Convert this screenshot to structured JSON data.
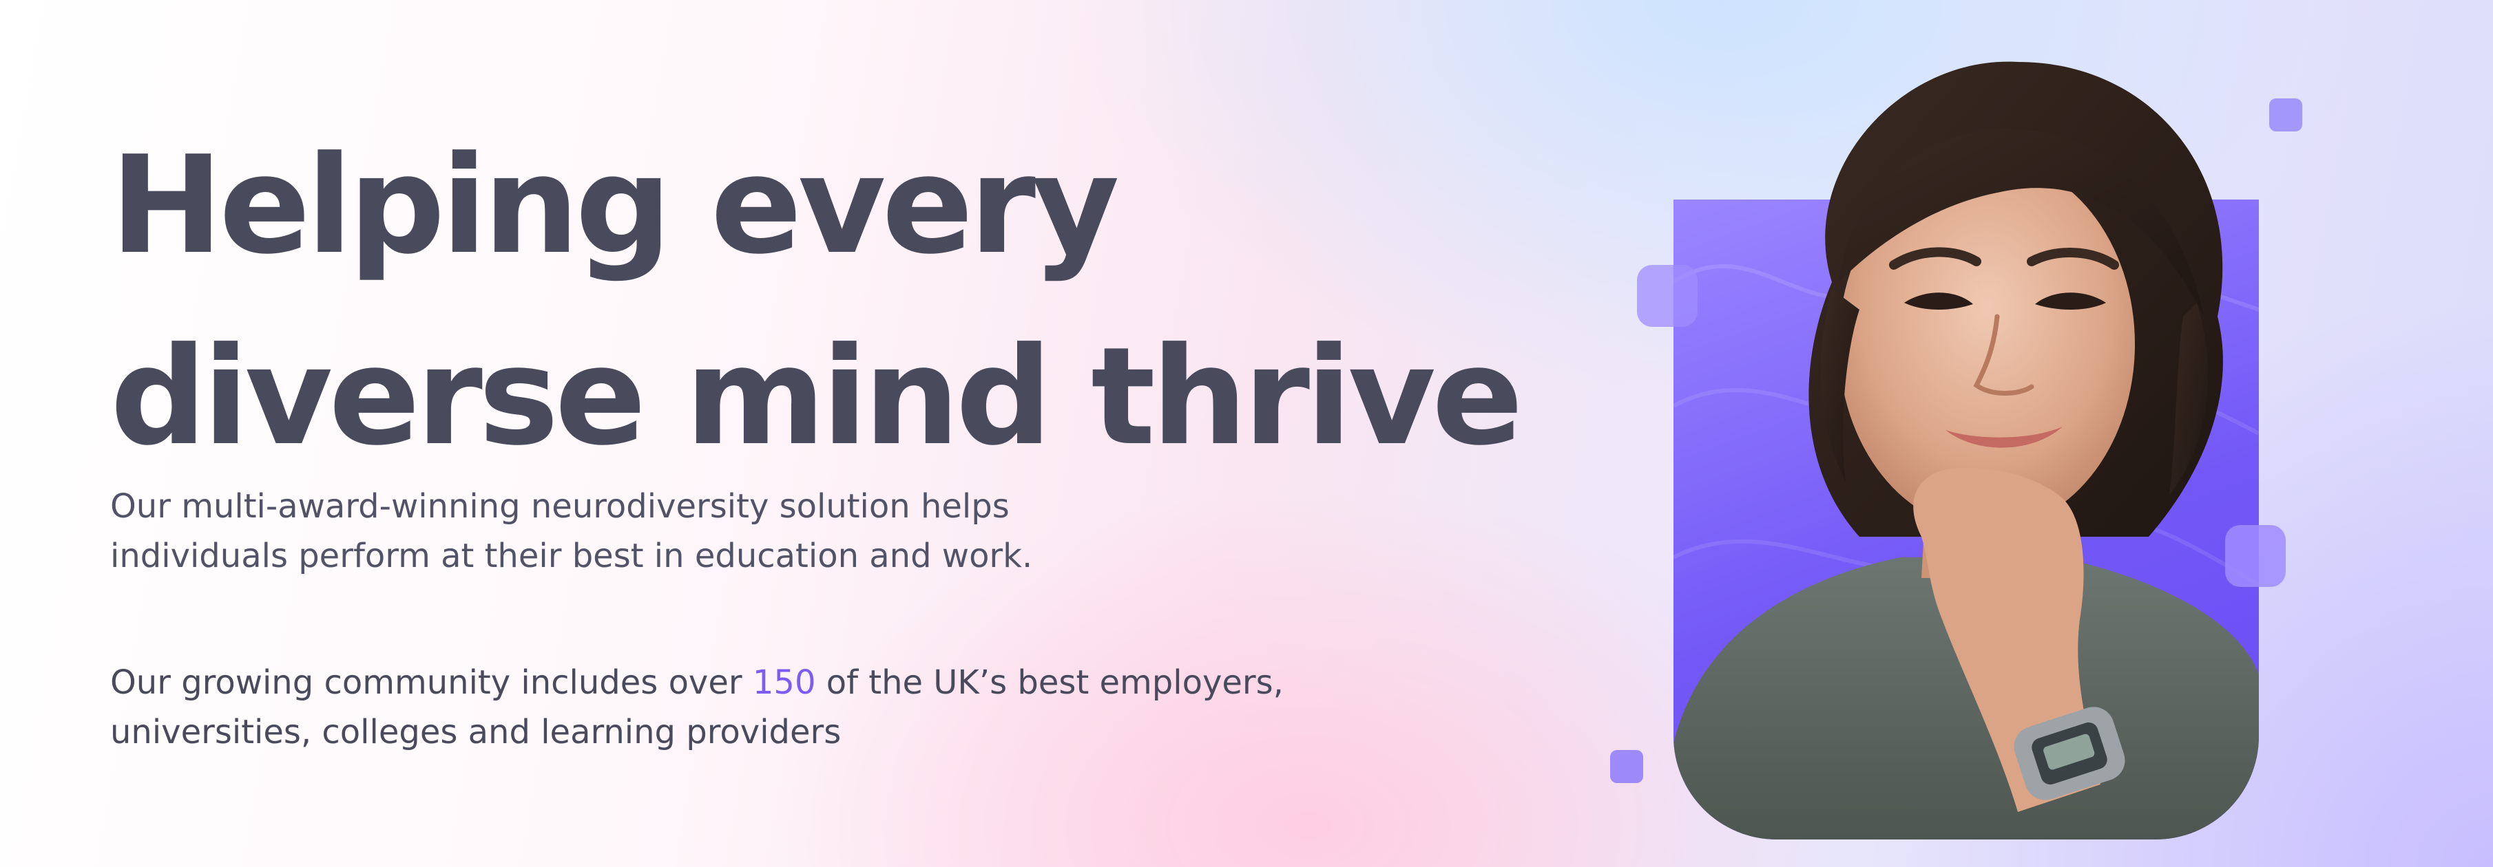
{
  "hero": {
    "headline_line1": "Helping every",
    "headline_line2": "diverse mind thrive",
    "description_line1": "Our multi-award-winning neurodiversity solution helps",
    "description_line2": "individuals perform at their best in education and work.",
    "community_prefix": "Our growing community includes over ",
    "community_highlight": "150",
    "community_suffix": " of the UK’s best employers,",
    "community_line2": "universities, colleges and learning providers"
  },
  "visual": {
    "image": "smiling-woman-portrait",
    "accent_color": "#7358f7",
    "highlight_color": "#7d5cf3",
    "text_color": "#494a5c"
  }
}
